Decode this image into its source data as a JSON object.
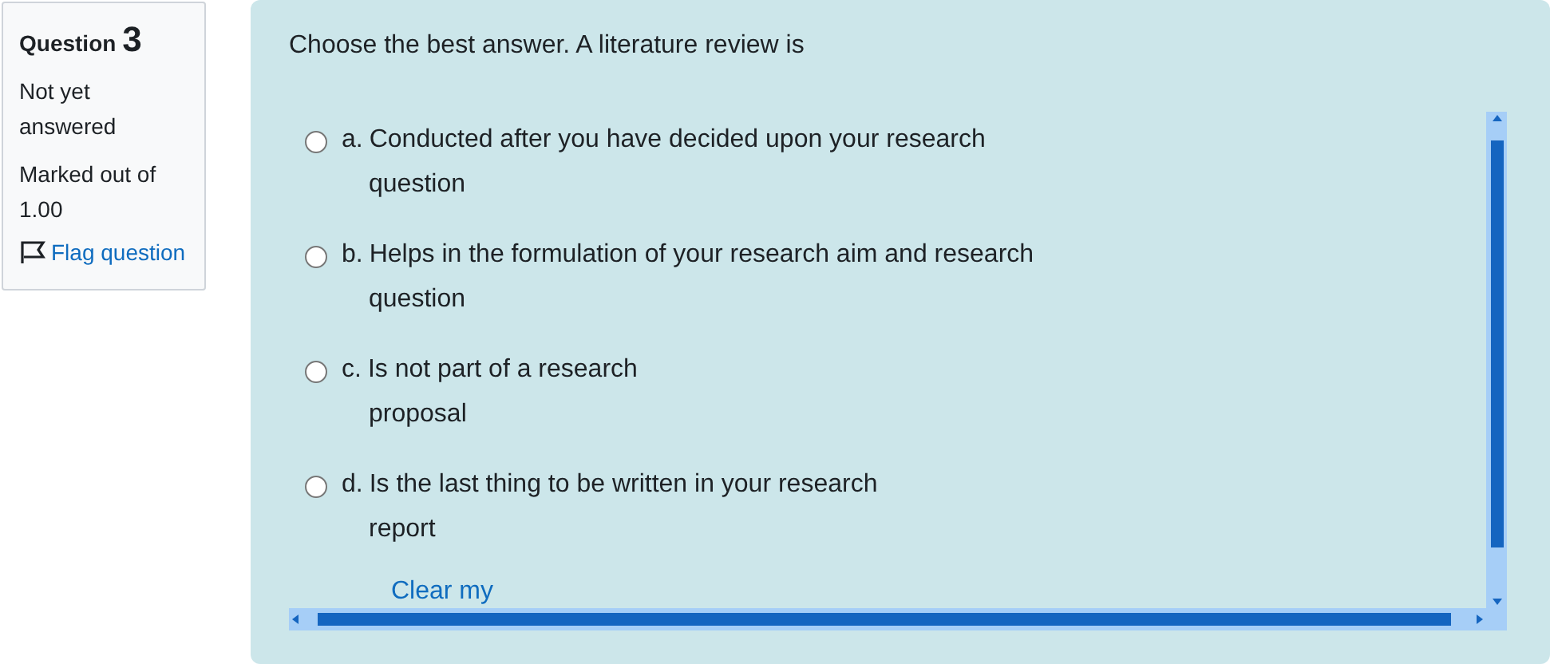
{
  "info": {
    "label": "Question",
    "number": "3",
    "status": "Not yet answered",
    "mark": "Marked out of 1.00",
    "flag": {
      "label": "Flag question",
      "flagged": false
    }
  },
  "question": {
    "prompt": "Choose the best answer. A literature review is",
    "options": [
      {
        "letter": "a.",
        "lines": [
          "Conducted after you have decided upon your research",
          "question"
        ],
        "selected": false
      },
      {
        "letter": "b.",
        "lines": [
          "Helps in the formulation of your research aim and research",
          "question"
        ],
        "selected": false
      },
      {
        "letter": "c.",
        "lines": [
          "Is not part of a research",
          "proposal"
        ],
        "selected": false
      },
      {
        "letter": "d.",
        "lines": [
          "Is the last thing to be written in your research",
          "report"
        ],
        "selected": false
      }
    ],
    "clear_link": "Clear my"
  }
}
